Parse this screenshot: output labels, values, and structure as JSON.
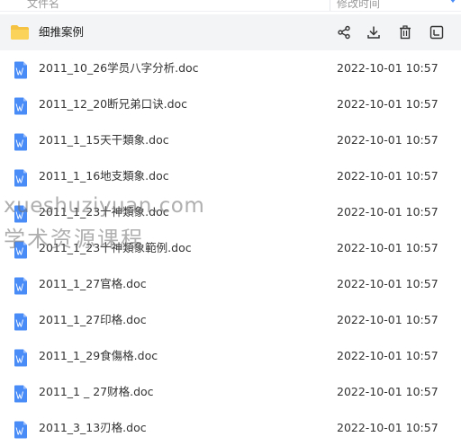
{
  "header": {
    "name_col": "文件名",
    "time_col": "修改时间"
  },
  "folder": {
    "name": "细推案例"
  },
  "icons": {
    "folder": "folder-icon",
    "file": "word-doc-icon",
    "share": "share-icon",
    "download": "download-icon",
    "delete": "trash-icon",
    "more": "more-icon"
  },
  "colors": {
    "folder": "#f5c242",
    "doc": "#4a8cf7",
    "row_highlight": "#f3f4f6"
  },
  "files": [
    {
      "name": "2011_10_26学员八字分析.doc",
      "time": "2022-10-01 10:57"
    },
    {
      "name": "2011_12_20断兄弟口诀.doc",
      "time": "2022-10-01 10:57"
    },
    {
      "name": "2011_1_15天干類象.doc",
      "time": "2022-10-01 10:57"
    },
    {
      "name": "2011_1_16地支類象.doc",
      "time": "2022-10-01 10:57"
    },
    {
      "name": "2011_1_23十神類象.doc",
      "time": "2022-10-01 10:57"
    },
    {
      "name": "2011_1_23十神類象範例.doc",
      "time": "2022-10-01 10:57"
    },
    {
      "name": "2011_1_27官格.doc",
      "time": "2022-10-01 10:57"
    },
    {
      "name": "2011_1_27印格.doc",
      "time": "2022-10-01 10:57"
    },
    {
      "name": "2011_1_29食傷格.doc",
      "time": "2022-10-01 10:57"
    },
    {
      "name": "2011_1 _ 27财格.doc",
      "time": "2022-10-01 10:57"
    },
    {
      "name": "2011_3_13刃格.doc",
      "time": "2022-10-01 10:57"
    }
  ],
  "watermark": {
    "line1": "xueshuziyuan.com",
    "line2": "学术资源课程"
  }
}
